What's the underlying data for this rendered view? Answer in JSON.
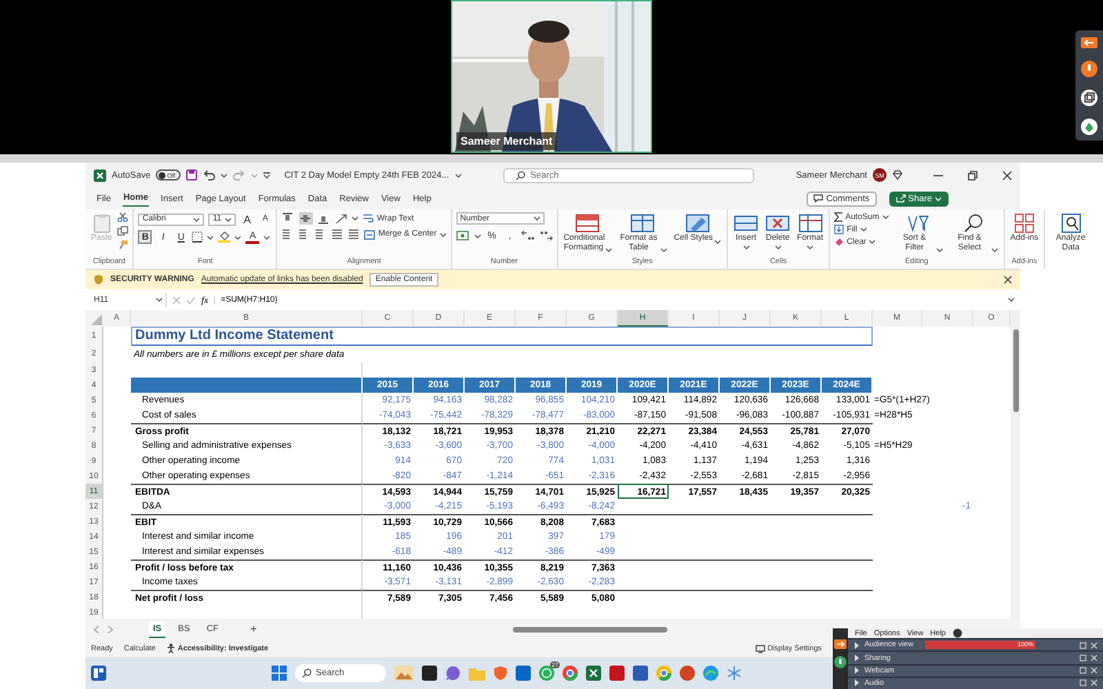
{
  "meeting": {
    "participant_name": "Sameer Merchant"
  },
  "excel": {
    "title_bar": {
      "autosave_label": "AutoSave",
      "autosave_toggle": {
        "label": "Off",
        "on": false
      },
      "document_title": "CIT 2 Day Model Empty 24th FEB  2024...",
      "search": {
        "placeholder": "Search"
      },
      "user_name": "Sameer Merchant",
      "avatar_initials": "SM"
    },
    "menu_tabs": [
      {
        "label": "File",
        "selected": false
      },
      {
        "label": "Home",
        "selected": true
      },
      {
        "label": "Insert",
        "selected": false
      },
      {
        "label": "Page Layout",
        "selected": false
      },
      {
        "label": "Formulas",
        "selected": false
      },
      {
        "label": "Data",
        "selected": false
      },
      {
        "label": "Review",
        "selected": false
      },
      {
        "label": "View",
        "selected": false
      },
      {
        "label": "Help",
        "selected": false
      }
    ],
    "comments_button": "Comments",
    "share_button": "Share",
    "ribbon": {
      "clipboard": {
        "label": "Clipboard",
        "paste": {
          "label": "Paste",
          "disabled": true
        }
      },
      "font": {
        "label": "Font",
        "font_name": "Calibri",
        "font_size": "11",
        "size_buttons": [
          "A",
          "A"
        ],
        "style_buttons": [
          {
            "label": "B",
            "selected": true
          },
          {
            "label": "I",
            "selected": false
          },
          {
            "label": "U",
            "selected": false
          }
        ],
        "font_color_button": "A"
      },
      "alignment": {
        "label": "Alignment",
        "vertical_align": [
          {
            "kind": "top",
            "selected": false
          },
          {
            "kind": "middle",
            "selected": true
          },
          {
            "kind": "bottom",
            "selected": false
          }
        ],
        "wrap_text": "Wrap Text",
        "merge_center": "Merge & Center"
      },
      "number": {
        "label": "Number",
        "format": "Number",
        "symbols": [
          "%",
          ","
        ]
      },
      "styles": {
        "label": "Styles",
        "buttons": [
          "Conditional Formatting",
          "Format as Table",
          "Cell Styles"
        ]
      },
      "cells": {
        "label": "Cells",
        "buttons": [
          "Insert",
          "Delete",
          "Format"
        ]
      },
      "editing": {
        "label": "Editing",
        "items": [
          "AutoSum",
          "Fill",
          "Clear"
        ],
        "buttons": [
          "Sort & Filter",
          "Find & Select"
        ]
      },
      "addins": {
        "label": "Add-ins",
        "buttons": [
          "Add-ins"
        ]
      },
      "analysis": {
        "buttons": [
          "Analyze Data"
        ]
      }
    },
    "security_bar": {
      "title": "SECURITY WARNING",
      "message": "Automatic update of links has been disabled",
      "button": "Enable Content"
    },
    "formula_bar": {
      "name_box": "H11",
      "function_label": "fx",
      "formula": "=SUM(H7:H10)"
    },
    "sheet": {
      "columns": [
        {
          "label": "A",
          "selected": false
        },
        {
          "label": "B",
          "selected": false
        },
        {
          "label": "C",
          "selected": false
        },
        {
          "label": "D",
          "selected": false
        },
        {
          "label": "E",
          "selected": false
        },
        {
          "label": "F",
          "selected": false
        },
        {
          "label": "G",
          "selected": false
        },
        {
          "label": "H",
          "selected": true
        },
        {
          "label": "I",
          "selected": false
        },
        {
          "label": "J",
          "selected": false
        },
        {
          "label": "K",
          "selected": false
        },
        {
          "label": "L",
          "selected": false
        },
        {
          "label": "M",
          "selected": false
        },
        {
          "label": "N",
          "selected": false
        },
        {
          "label": "O",
          "selected": false
        }
      ],
      "rows": [
        {
          "number": "1",
          "selected": false,
          "kind": "title",
          "label": "Dummy Ltd Income Statement"
        },
        {
          "number": "2",
          "selected": false,
          "kind": "subtitle",
          "label": "All numbers are in £ millions except per share data"
        },
        {
          "number": "3",
          "selected": false,
          "kind": "blank"
        },
        {
          "number": "4",
          "selected": false,
          "kind": "header",
          "values": [
            {
              "text": "2015",
              "kind": "actual"
            },
            {
              "text": "2016",
              "kind": "actual"
            },
            {
              "text": "2017",
              "kind": "actual"
            },
            {
              "text": "2018",
              "kind": "actual"
            },
            {
              "text": "2019",
              "kind": "actual"
            },
            {
              "text": "2020E",
              "kind": "forecast"
            },
            {
              "text": "2021E",
              "kind": "forecast"
            },
            {
              "text": "2022E",
              "kind": "forecast"
            },
            {
              "text": "2023E",
              "kind": "forecast"
            },
            {
              "text": "2024E",
              "kind": "forecast"
            }
          ]
        },
        {
          "number": "5",
          "selected": false,
          "kind": "item",
          "label": "Revenues",
          "values": [
            "92,175",
            "94,163",
            "98,282",
            "96,855",
            "104,210",
            "109,421",
            "114,892",
            "120,636",
            "126,668",
            "133,001"
          ],
          "column_m": "=G5*(1+H27)"
        },
        {
          "number": "6",
          "selected": false,
          "kind": "item",
          "label": "Cost of sales",
          "values": [
            "-74,043",
            "-75,442",
            "-78,329",
            "-78,477",
            "-83,000",
            "-87,150",
            "-91,508",
            "-96,083",
            "-100,887",
            "-105,931"
          ],
          "column_m": "=H28*H5"
        },
        {
          "number": "7",
          "selected": false,
          "kind": "total",
          "label": "Gross profit",
          "values": [
            "18,132",
            "18,721",
            "19,953",
            "18,378",
            "21,210",
            "22,271",
            "23,384",
            "24,553",
            "25,781",
            "27,070"
          ]
        },
        {
          "number": "8",
          "selected": false,
          "kind": "item",
          "label": "Selling and administrative expenses",
          "values": [
            "-3,633",
            "-3,600",
            "-3,700",
            "-3,800",
            "-4,000",
            "-4,200",
            "-4,410",
            "-4,631",
            "-4,862",
            "-5,105"
          ],
          "column_m": "=H5*H29"
        },
        {
          "number": "9",
          "selected": false,
          "kind": "item",
          "label": "Other operating income",
          "values": [
            "914",
            "670",
            "720",
            "774",
            "1,031",
            "1,083",
            "1,137",
            "1,194",
            "1,253",
            "1,316"
          ]
        },
        {
          "number": "10",
          "selected": false,
          "kind": "item",
          "label": "Other operating expenses",
          "values": [
            "-820",
            "-847",
            "-1,214",
            "-651",
            "-2,316",
            "-2,432",
            "-2,553",
            "-2,681",
            "-2,815",
            "-2,956"
          ]
        },
        {
          "number": "11",
          "selected": true,
          "kind": "total",
          "label": "EBITDA",
          "values": [
            "14,593",
            "14,944",
            "15,759",
            "14,701",
            "15,925",
            "16,721",
            "17,557",
            "18,435",
            "19,357",
            "20,325"
          ]
        },
        {
          "number": "12",
          "selected": false,
          "kind": "item",
          "label": "D&A",
          "values": [
            "-3,000",
            "-4,215",
            "-5,193",
            "-6,493",
            "-8,242"
          ],
          "column_n": "-1"
        },
        {
          "number": "13",
          "selected": false,
          "kind": "total",
          "label": "EBIT",
          "values": [
            "11,593",
            "10,729",
            "10,566",
            "8,208",
            "7,683"
          ]
        },
        {
          "number": "14",
          "selected": false,
          "kind": "item",
          "label": "Interest and similar income",
          "values": [
            "185",
            "196",
            "201",
            "397",
            "179"
          ]
        },
        {
          "number": "15",
          "selected": false,
          "kind": "item",
          "label": "Interest and similar expenses",
          "values": [
            "-618",
            "-489",
            "-412",
            "-386",
            "-499"
          ]
        },
        {
          "number": "16",
          "selected": false,
          "kind": "total",
          "label": "Profit / loss before tax",
          "values": [
            "11,160",
            "10,436",
            "10,355",
            "8,219",
            "7,363"
          ]
        },
        {
          "number": "17",
          "selected": false,
          "kind": "item",
          "label": "Income taxes",
          "values": [
            "-3,571",
            "-3,131",
            "-2,899",
            "-2,630",
            "-2,283"
          ]
        },
        {
          "number": "18",
          "selected": false,
          "kind": "total",
          "label": "Net profit / loss",
          "values": [
            "7,589",
            "7,305",
            "7,456",
            "5,589",
            "5,080"
          ]
        },
        {
          "number": "19",
          "selected": false,
          "kind": "blank"
        }
      ]
    },
    "sheet_tabs": [
      {
        "label": "IS",
        "selected": true
      },
      {
        "label": "BS",
        "selected": false
      },
      {
        "label": "CF",
        "selected": false
      }
    ],
    "add_sheet": "+",
    "status_bar": {
      "items": [
        "Ready",
        "Calculate"
      ],
      "accessibility": "Accessibility: Investigate",
      "display_settings": "Display Settings"
    }
  },
  "taskbar": {
    "search": {
      "placeholder": "Search"
    },
    "badge": "27"
  },
  "control_panel": {
    "menu": [
      "File",
      "Options",
      "View",
      "Help"
    ],
    "sections": [
      {
        "label": "Audience view",
        "kind": "meter",
        "expanded": false,
        "level": 1,
        "reading": "100%"
      },
      {
        "label": "Sharing",
        "kind": "plain",
        "expanded": false
      },
      {
        "label": "Webcam",
        "kind": "plain",
        "expanded": false
      },
      {
        "label": "Audio",
        "kind": "plain",
        "expanded": false
      }
    ]
  }
}
